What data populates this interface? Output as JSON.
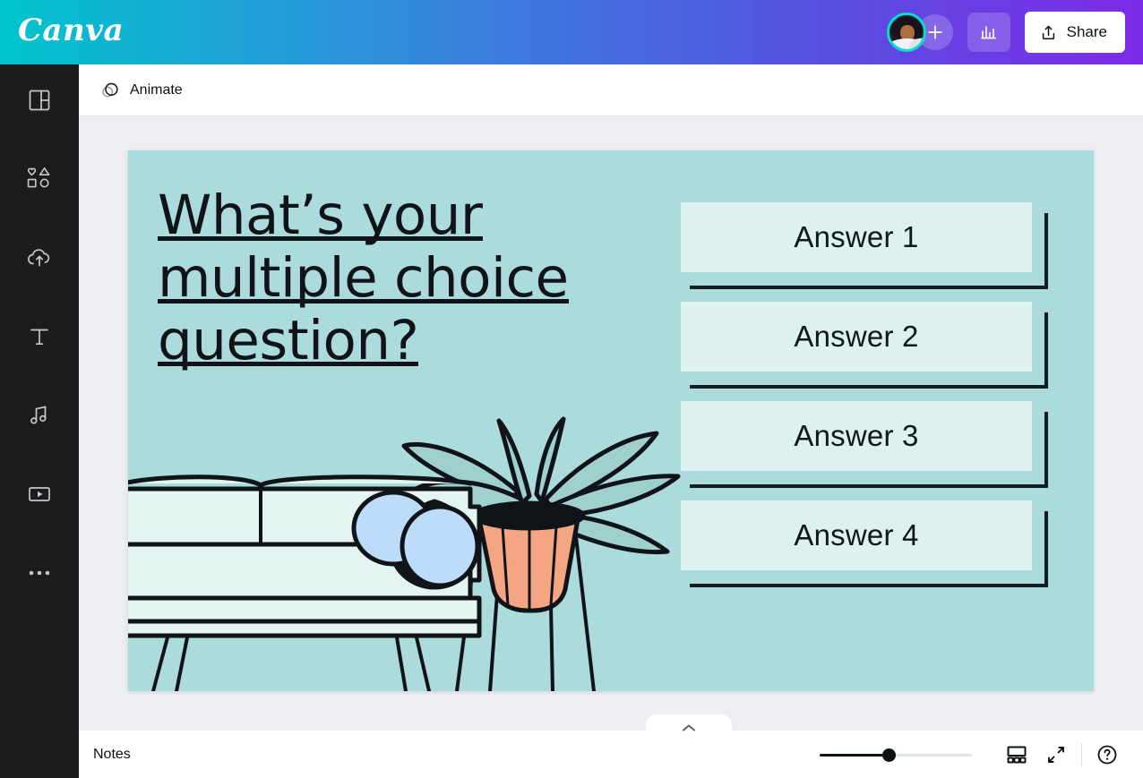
{
  "app": {
    "name": "Canva",
    "logo_text": "Canva"
  },
  "header": {
    "avatar": {
      "icon": "avatar",
      "alt": "user-avatar"
    },
    "add_collaborator": {
      "icon": "plus-icon",
      "label": "+"
    },
    "insights": {
      "icon": "bar-chart-icon"
    },
    "share": {
      "label": "Share",
      "icon": "upload-icon"
    },
    "gradient_start": "#00C4CC",
    "gradient_mid": "#3A7FDD",
    "gradient_end": "#7D2AE8"
  },
  "sidebar": {
    "items": [
      {
        "name": "templates",
        "icon": "layout-grid-icon"
      },
      {
        "name": "elements",
        "icon": "shapes-icon"
      },
      {
        "name": "uploads",
        "icon": "cloud-upload-icon"
      },
      {
        "name": "text",
        "icon": "text-t-icon"
      },
      {
        "name": "audio",
        "icon": "music-note-icon"
      },
      {
        "name": "videos",
        "icon": "video-play-icon"
      },
      {
        "name": "more",
        "icon": "ellipsis-icon"
      }
    ],
    "background": "#1C1C1E"
  },
  "toolbar": {
    "animate": {
      "label": "Animate",
      "icon": "animate-circles-icon"
    }
  },
  "slide": {
    "background": "#ABDCDB",
    "headline_lines": [
      "What’s your",
      "multiple choice",
      "question?"
    ],
    "answers": [
      {
        "label": "Answer 1"
      },
      {
        "label": "Answer 2"
      },
      {
        "label": "Answer 3"
      },
      {
        "label": "Answer 4"
      }
    ],
    "answer_card_fill": "#DDF1EF",
    "answer_card_outline": "#151C22",
    "illustration": {
      "name": "living-room-illustration",
      "couch_fill": "#E3F4F1",
      "pillow_fill": "#B9DCF7",
      "pot_fill": "#F4A581",
      "leaf_fill": "#9FD0CC",
      "outline": "#101418"
    }
  },
  "bottom_bar": {
    "notes_label": "Notes",
    "expand_notes": {
      "icon": "chevron-up-icon"
    },
    "zoom": {
      "value": 45,
      "min": 0,
      "max": 100
    },
    "page_view": {
      "icon": "grid-view-icon"
    },
    "fullscreen": {
      "icon": "expand-arrows-icon"
    },
    "help": {
      "icon": "question-circle-icon"
    }
  }
}
